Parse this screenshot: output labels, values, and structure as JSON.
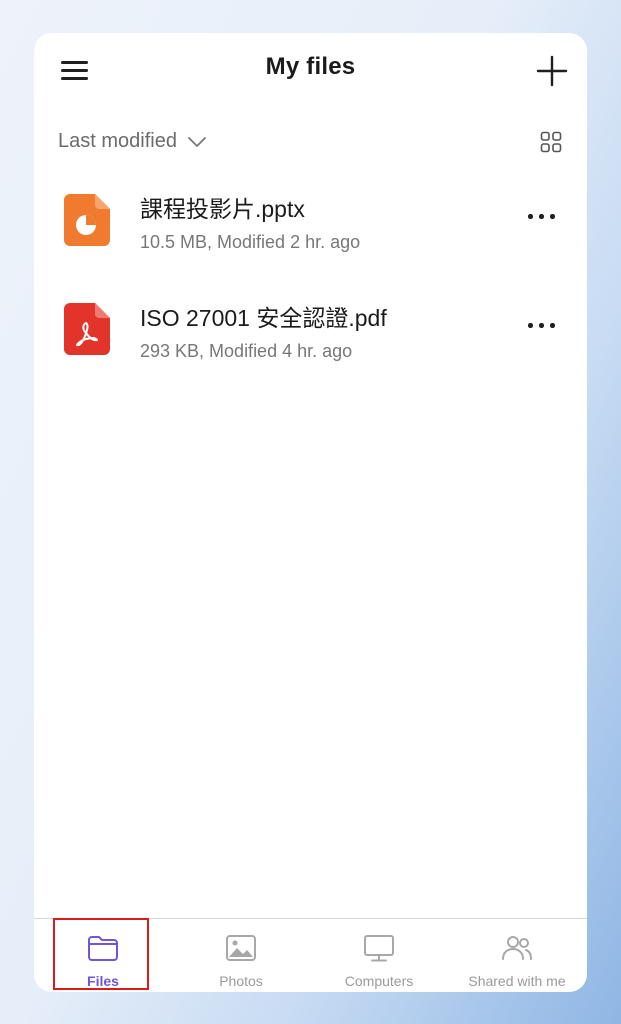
{
  "header": {
    "title": "My files",
    "menu_icon": "hamburger-menu-icon",
    "add_icon": "plus-icon"
  },
  "toolbar": {
    "sort_label": "Last modified",
    "sort_icon": "chevron-down-icon",
    "view_icon": "grid-view-icon"
  },
  "files": [
    {
      "name": "課程投影片.pptx",
      "meta": "10.5 MB, Modified 2 hr. ago",
      "icon": "powerpoint-file-icon",
      "icon_color": "#F07B2E"
    },
    {
      "name": "ISO 27001 安全認證.pdf",
      "meta": "293 KB, Modified 4 hr. ago",
      "icon": "pdf-file-icon",
      "icon_color": "#E2342A"
    }
  ],
  "tabs": [
    {
      "label": "Files",
      "icon": "folder-icon",
      "active": true
    },
    {
      "label": "Photos",
      "icon": "image-icon",
      "active": false
    },
    {
      "label": "Computers",
      "icon": "monitor-icon",
      "active": false
    },
    {
      "label": "Shared with me",
      "icon": "people-icon",
      "active": false
    }
  ],
  "colors": {
    "accent": "#6F55D9",
    "highlight_box": "#D81C1C"
  }
}
